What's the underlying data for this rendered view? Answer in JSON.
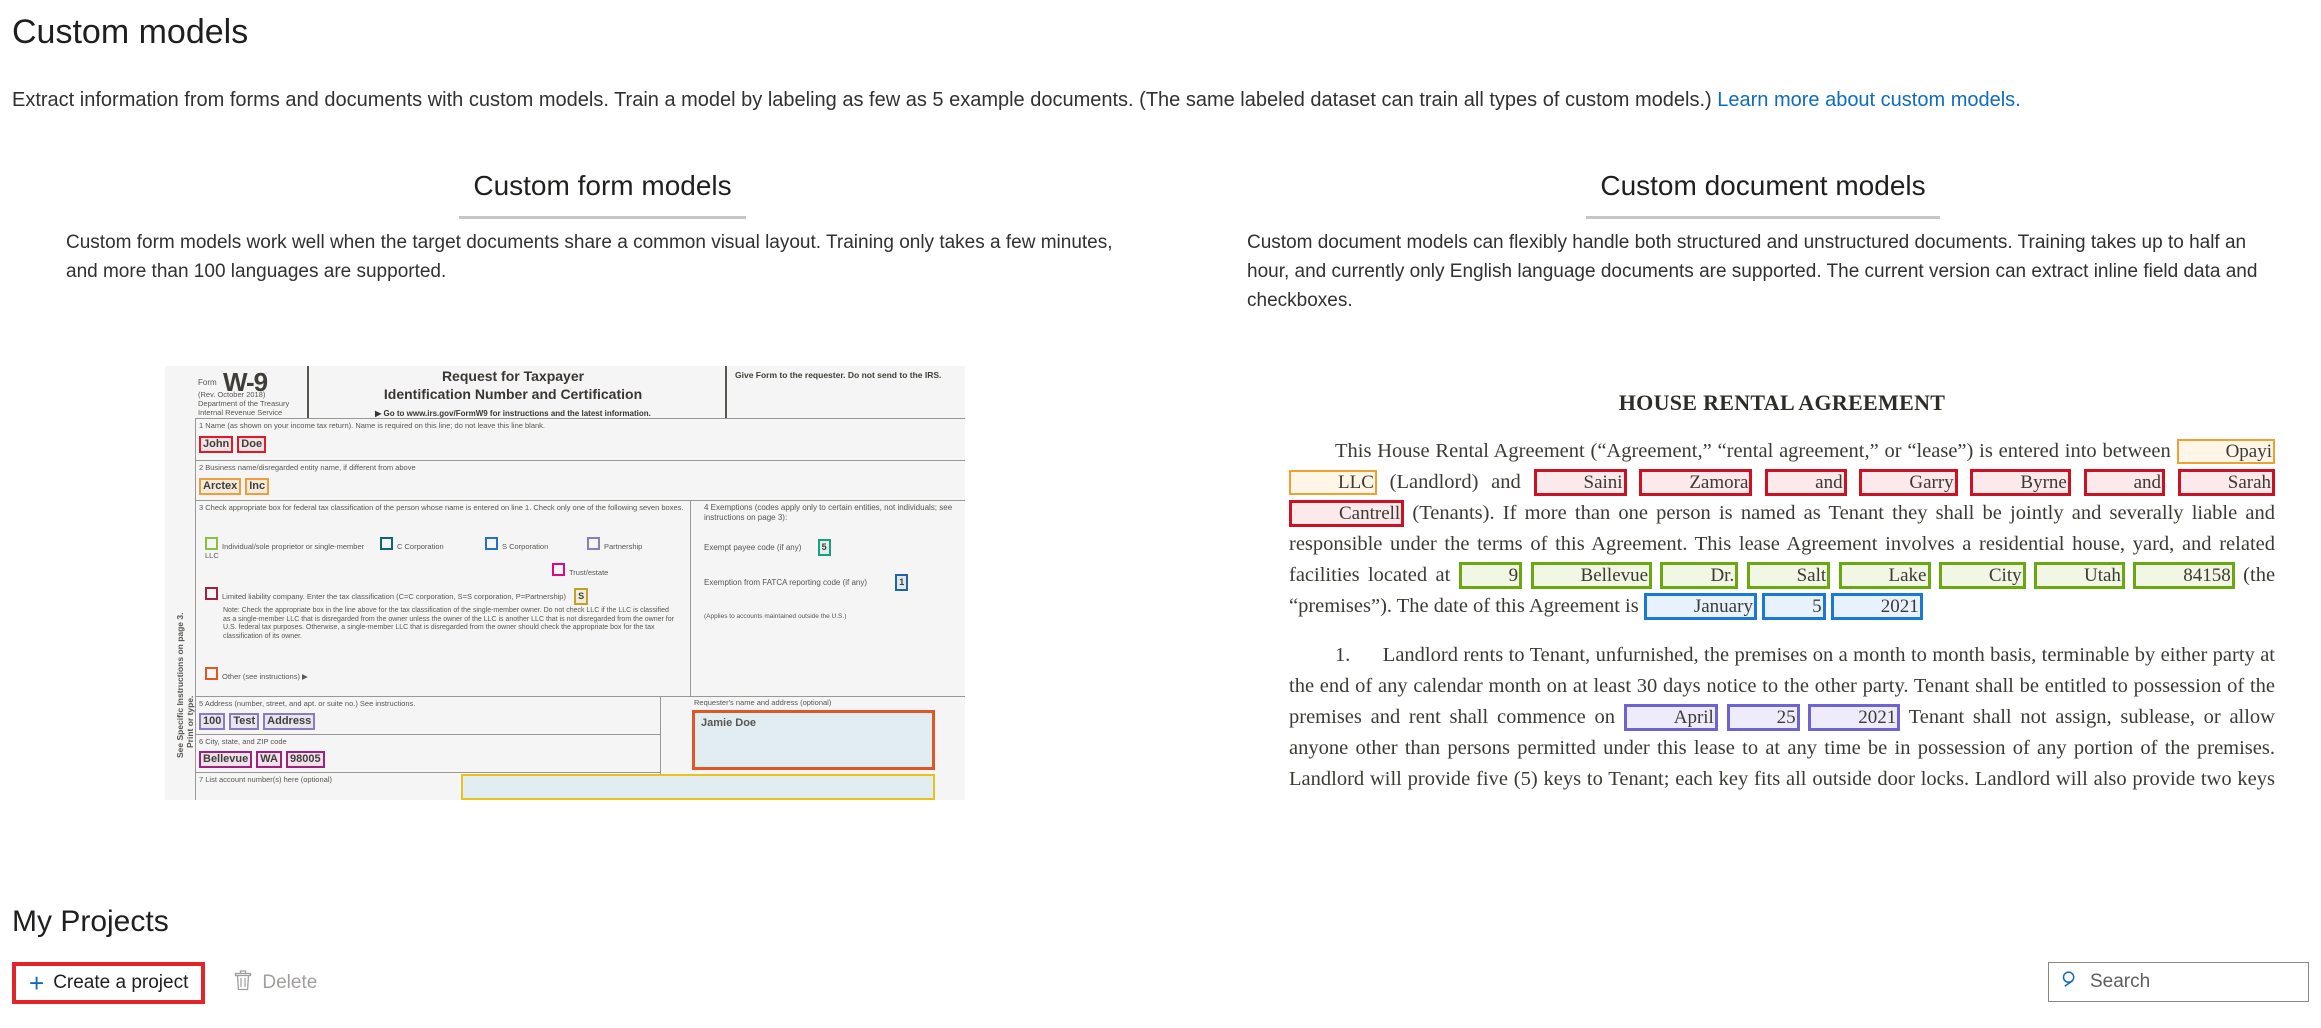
{
  "header": {
    "title": "Custom models",
    "description_before_link": "Extract information from forms and documents with custom models. Train a model by labeling as few as 5 example documents. (The same labeled dataset can train all types of custom models.) ",
    "link_text": "Learn more about custom models."
  },
  "columns": [
    {
      "title": "Custom form models",
      "body": "Custom form models work well when the target documents share a common visual layout. Training only takes a few minutes, and more than 100 languages are supported."
    },
    {
      "title": "Custom document models",
      "body": "Custom document models can flexibly handle both structured and unstructured documents. Training takes up to half an hour, and currently only English language documents are supported. The current version can extract inline field data and checkboxes."
    }
  ],
  "w9_sample": {
    "side_text_1": "Print or type.",
    "side_text_2": "See Specific Instructions on page 3.",
    "form_label": "Form",
    "form_number": "W-9",
    "revision": "(Rev. October 2018)",
    "department": "Department of the Treasury",
    "agency": "Internal Revenue Service",
    "title_line1": "Request for Taxpayer",
    "title_line2": "Identification Number and Certification",
    "goto_line": "▶ Go to www.irs.gov/FormW9 for instructions and the latest information.",
    "give_form_note": "Give Form to the requester. Do not send to the IRS.",
    "line1_label": "1  Name (as shown on your income tax return). Name is required on this line; do not leave this line blank.",
    "line1_value_a": "John",
    "line1_value_b": "Doe",
    "line2_label": "2  Business name/disregarded entity name, if different from above",
    "line2_value_a": "Arctex",
    "line2_value_b": "Inc",
    "line3_label": "3  Check appropriate box for federal tax classification of the person whose name is entered on line 1. Check only one of the following seven boxes.",
    "cb_individual": "Individual/sole proprietor or single-member LLC",
    "cb_c_corp": "C Corporation",
    "cb_s_corp": "S Corporation",
    "cb_partnership": "Partnership",
    "cb_trust": "Trust/estate",
    "cb_llc": "Limited liability company. Enter the tax classification (C=C corporation, S=S corporation, P=Partnership)",
    "llc_value": "S",
    "llc_note": "Note: Check the appropriate box in the line above for the tax classification of the single-member owner.  Do not check LLC if the LLC is classified as a single-member LLC that is disregarded from the owner unless the owner of the LLC is another LLC that is not disregarded from the owner for U.S. federal tax purposes. Otherwise, a single-member LLC that is disregarded from the owner should check the appropriate box for the tax classification of its owner.",
    "cb_other": "Other (see instructions) ▶",
    "line4_label": "4  Exemptions (codes apply only to certain entities, not individuals; see instructions on page 3):",
    "exempt_payee_label": "Exempt payee code (if any)",
    "exempt_payee_value": "5",
    "fatca_label": "Exemption from FATCA reporting code (if any)",
    "fatca_value": "1",
    "fatca_note": "(Applies to accounts maintained outside the U.S.)",
    "line5_label": "5  Address (number, street, and apt. or suite no.) See instructions.",
    "line5_value_a": "100",
    "line5_value_b": "Test",
    "line5_value_c": "Address",
    "line6_label": "6  City, state, and ZIP code",
    "line6_value_a": "Bellevue",
    "line6_value_b": "WA",
    "line6_value_c": "98005",
    "line7_label": "7  List account number(s) here (optional)",
    "requester_label": "Requester's name and address (optional)",
    "requester_value": "Jamie Doe"
  },
  "lease_sample": {
    "title": "HOUSE RENTAL AGREEMENT",
    "p1_part1": "This House Rental Agreement (“Agreement,” “rental agreement,” or “lease”) is entered into between ",
    "landlord_1": "Opayi",
    "landlord_2": "LLC",
    "p1_part2": " (Landlord) and ",
    "tenant_1": "Saini",
    "tenant_2": "Zamora",
    "tenant_and_1": "and",
    "tenant_3": "Garry",
    "tenant_4": "Byrne",
    "tenant_and_2": "and",
    "tenant_5": "Sarah",
    "tenant_6": "Cantrell",
    "p1_part3": " (Tenants).   If more than one person is named as Tenant they shall be jointly and severally liable and responsible under the terms of this Agreement.  This lease Agreement involves a residential house, yard, and related facilities located at ",
    "addr_1": "9",
    "addr_2": "Bellevue",
    "addr_3": "Dr.",
    "addr_4": "Salt",
    "addr_5": "Lake",
    "addr_6": "City",
    "addr_7": "Utah",
    "addr_8": "84158",
    "p1_part4": " (the “premises”). The date of this Agreement is ",
    "date_month": "January",
    "date_day": "5",
    "date_year": "2021",
    "p2_number": "1.",
    "p2_part1": "Landlord rents to Tenant, unfurnished, the premises on a month to month basis, terminable by either party at the end of any calendar month on at least 30 days notice to the other party.  Tenant shall be entitled to possession of the premises and rent shall commence on ",
    "start_month": "April",
    "start_day": "25",
    "start_year": "2021",
    "p2_part2": "  Tenant shall not assign, sublease, or allow anyone other than persons permitted under this lease to at any time be in possession of any portion of the premises.  Landlord will provide five (5) keys to Tenant; each key fits all outside door locks.  Landlord will also provide two keys to the garage, and one remote garage door opener.  All keys and the remote door opener will be returned"
  },
  "projects": {
    "title": "My Projects",
    "create_label": "Create a project",
    "delete_label": "Delete",
    "search_placeholder": "Search",
    "search_value": ""
  },
  "colors": {
    "link": "#0f6cbd",
    "highlight_border": "#e3242b",
    "accent_blue": "#0f6cbd",
    "divider": "#c8c6c4"
  }
}
